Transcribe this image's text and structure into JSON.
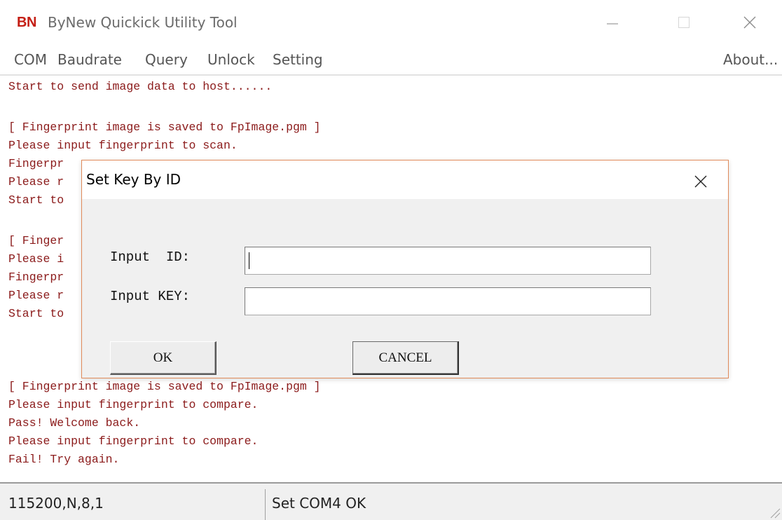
{
  "window": {
    "logo": "BN",
    "title": "ByNew Quickick Utility Tool"
  },
  "menu": {
    "items": [
      "COM",
      "Baudrate",
      "Query",
      "Unlock",
      "Setting"
    ],
    "about": "About..."
  },
  "log": {
    "lines": [
      "Start to send image data to host......",
      "",
      "[ Fingerprint image is saved to FpImage.pgm ]",
      "Please input fingerprint to scan.",
      "Fingerpr",
      "Please r",
      "Start to",
      "",
      "[ Finger",
      "Please i",
      "Fingerpr",
      "Please r",
      "Start to",
      "",
      "[ Fingerprint image is saved to FpImage.pgm ]",
      "Please input fingerprint to compare.",
      "Pass! Welcome back.",
      "Please input fingerprint to compare.",
      "Fail! Try again."
    ]
  },
  "status": {
    "baud": "115200,N,8,1",
    "message": "Set COM4 OK"
  },
  "dialog": {
    "title": "Set Key By ID",
    "id_label": "Input  ID:",
    "id_value": "",
    "key_label": "Input KEY:",
    "key_value": "",
    "ok_label": "OK",
    "cancel_label": "CANCEL"
  },
  "colors": {
    "log_text": "#8b1a1a",
    "logo": "#c41e14",
    "dialog_border": "#e08a5a"
  }
}
